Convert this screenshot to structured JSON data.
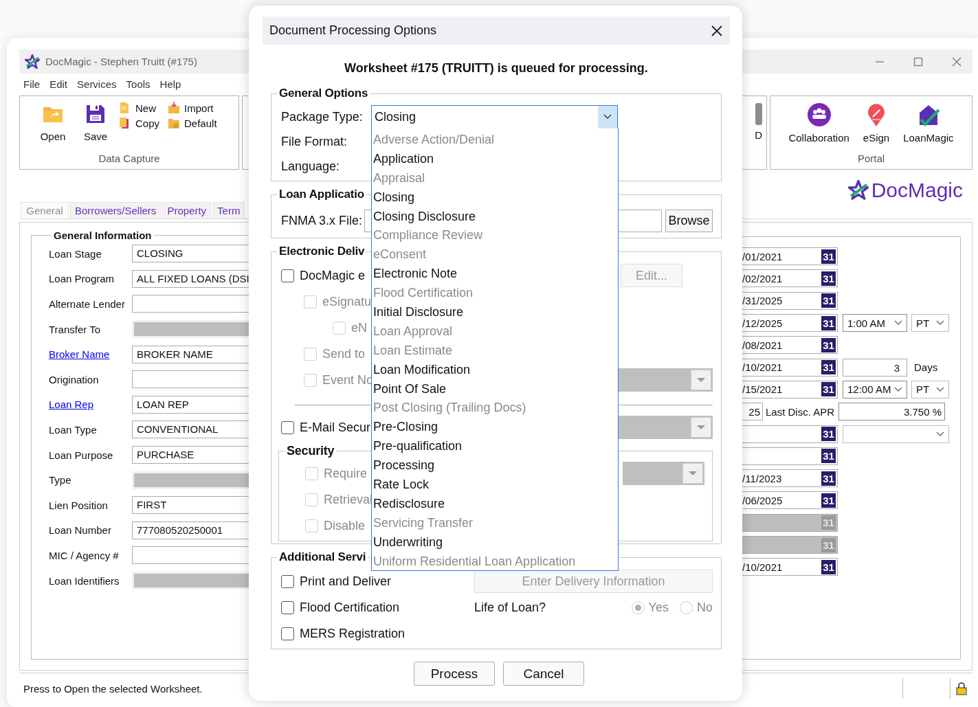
{
  "app": {
    "title": "DocMagic - Stephen Truitt (#175)",
    "menu": [
      "File",
      "Edit",
      "Services",
      "Tools",
      "Help"
    ],
    "data_capture": {
      "label": "Data Capture",
      "large": [
        "Open",
        "Save"
      ],
      "small": [
        "New",
        "Copy",
        "Import",
        "Default"
      ]
    },
    "partial_group": {
      "label": "D"
    },
    "portal": {
      "label": "Portal",
      "items": [
        "Collaboration",
        "eSign",
        "LoanMagic"
      ]
    },
    "brand": "DocMagic",
    "tabs": [
      {
        "label": "General",
        "selected": true
      },
      {
        "label": "Borrowers/Sellers",
        "selected": false
      },
      {
        "label": "Property",
        "selected": false
      },
      {
        "label": "Term",
        "selected": false
      }
    ],
    "general_information": {
      "title": "General Information",
      "rows": [
        {
          "label": "Loan Stage",
          "value": "CLOSING",
          "link": false,
          "disabled": false
        },
        {
          "label": "Loan Program",
          "value": "ALL FIXED LOANS (DSI",
          "link": false,
          "disabled": false
        },
        {
          "label": "Alternate Lender",
          "link": false,
          "disabled": false
        },
        {
          "label": "Transfer To",
          "link": false,
          "disabled": true
        },
        {
          "label": "Broker Name",
          "value": "BROKER NAME",
          "link": true,
          "disabled": false
        },
        {
          "label": "Origination",
          "link": false,
          "disabled": false
        },
        {
          "label": "Loan Rep",
          "value": "LOAN REP",
          "link": true,
          "disabled": false
        },
        {
          "label": "Loan Type",
          "value": "CONVENTIONAL",
          "link": false,
          "disabled": false
        },
        {
          "label": "Loan Purpose",
          "value": "PURCHASE",
          "link": false,
          "disabled": false
        },
        {
          "label": "Type",
          "link": false,
          "disabled": true
        },
        {
          "label": "Lien Position",
          "value": "FIRST",
          "link": false,
          "disabled": false
        },
        {
          "label": "Loan Number",
          "value": "777080520250001",
          "link": false,
          "disabled": false
        },
        {
          "label": "MIC / Agency #",
          "link": false,
          "disabled": false
        },
        {
          "label": "Loan Identifiers",
          "link": false,
          "disabled": true
        }
      ]
    },
    "date_rows": [
      {
        "kind": "date",
        "date": "/01/2021",
        "calendar": "31",
        "disabled": false
      },
      {
        "kind": "date",
        "date": "/02/2021",
        "calendar": "31",
        "disabled": false
      },
      {
        "kind": "date",
        "date": "/31/2025",
        "calendar": "31",
        "disabled": false
      },
      {
        "kind": "time",
        "date": "/12/2025",
        "calendar": "31",
        "disabled": false,
        "time": "1:00 AM",
        "zone": "PT"
      },
      {
        "kind": "date",
        "date": "/08/2021",
        "calendar": "31",
        "disabled": false
      },
      {
        "kind": "days",
        "date": "/10/2021",
        "calendar": "31",
        "disabled": false,
        "days": "3",
        "unit": "Days"
      },
      {
        "kind": "time",
        "date": "/15/2021",
        "calendar": "31",
        "disabled": false,
        "time": "12:00 AM",
        "zone": "PT"
      },
      {
        "kind": "apr",
        "count": "25",
        "label": "Last Disc. APR",
        "value": "3.750 %"
      },
      {
        "kind": "select",
        "calendar": "31",
        "disabled": false
      },
      {
        "kind": "date",
        "calendar": "31",
        "disabled": false
      },
      {
        "kind": "date",
        "date": "/11/2023",
        "calendar": "31",
        "disabled": false
      },
      {
        "kind": "date",
        "date": "/06/2025",
        "calendar": "31",
        "disabled": false
      },
      {
        "kind": "date",
        "calendar": "31",
        "disabled": true
      },
      {
        "kind": "date",
        "calendar": "31",
        "disabled": true
      },
      {
        "kind": "date",
        "date": "/10/2021",
        "calendar": "31",
        "disabled": false
      }
    ],
    "status": "Press to Open the selected Worksheet."
  },
  "dialog": {
    "title": "Document Processing Options",
    "message": "Worksheet #175 (TRUITT) is queued for processing.",
    "general_options": {
      "legend": "General Options",
      "package_type": {
        "label": "Package Type:",
        "value": "Closing",
        "expanded": true,
        "options": [
          {
            "label": "Adverse Action/Denial",
            "disabled": true
          },
          {
            "label": "Application",
            "disabled": false
          },
          {
            "label": "Appraisal",
            "disabled": true
          },
          {
            "label": "Closing",
            "disabled": false
          },
          {
            "label": "Closing Disclosure",
            "disabled": false
          },
          {
            "label": "Compliance Review",
            "disabled": true
          },
          {
            "label": "eConsent",
            "disabled": true
          },
          {
            "label": "Electronic Note",
            "disabled": false
          },
          {
            "label": "Flood Certification",
            "disabled": true
          },
          {
            "label": "Initial Disclosure",
            "disabled": false
          },
          {
            "label": "Loan Approval",
            "disabled": true
          },
          {
            "label": "Loan Estimate",
            "disabled": true
          },
          {
            "label": "Loan Modification",
            "disabled": false
          },
          {
            "label": "Point Of Sale",
            "disabled": false
          },
          {
            "label": "Post Closing (Trailing Docs)",
            "disabled": true
          },
          {
            "label": "Pre-Closing",
            "disabled": false
          },
          {
            "label": "Pre-qualification",
            "disabled": false
          },
          {
            "label": "Processing",
            "disabled": false
          },
          {
            "label": "Rate Lock",
            "disabled": false
          },
          {
            "label": "Redisclosure",
            "disabled": false
          },
          {
            "label": "Servicing Transfer",
            "disabled": true
          },
          {
            "label": "Underwriting",
            "disabled": false
          },
          {
            "label": "Uniform Residential Loan Application",
            "disabled": true
          }
        ]
      },
      "file_format_label": "File Format:",
      "language_label": "Language:"
    },
    "loan_application": {
      "legend": "Loan Applicatio",
      "file_label": "FNMA 3.x File:",
      "browse": "Browse"
    },
    "electronic_delivery": {
      "legend": "Electronic Deliv",
      "items": [
        {
          "label": "DocMagic e",
          "checked": false,
          "disabled": false,
          "button": {
            "label": "Edit...",
            "disabled": true
          },
          "children": [
            {
              "label": "eSignatu",
              "checked": false,
              "disabled": true,
              "children": [
                {
                  "label": "eN",
                  "checked": false,
                  "disabled": true
                }
              ]
            },
            {
              "label": "Send to",
              "checked": false,
              "disabled": true
            },
            {
              "label": "Event No",
              "checked": false,
              "disabled": true,
              "select": {
                "disabled": true
              }
            }
          ]
        }
      ],
      "email": {
        "label": "E-Mail Secur",
        "checked": false,
        "disabled": false,
        "select": {
          "disabled": true
        }
      },
      "security": {
        "legend": "Security",
        "items": [
          {
            "label": "Require",
            "checked": false,
            "disabled": true,
            "select": {
              "disabled": true
            }
          },
          {
            "label": "Retrieval",
            "checked": false,
            "disabled": true
          },
          {
            "label": "Disable",
            "checked": false,
            "disabled": true
          }
        ]
      }
    },
    "additional_services": {
      "legend": "Additional Servi",
      "print": {
        "label": "Print and Deliver",
        "checked": false,
        "disabled": false
      },
      "delivery_button": {
        "label": "Enter Delivery Information",
        "disabled": true
      },
      "flood": {
        "label": "Flood Certification",
        "checked": false,
        "disabled": false
      },
      "life_of_loan": {
        "label": "Life of Loan?",
        "options": [
          {
            "label": "Yes",
            "selected": true,
            "disabled": true
          },
          {
            "label": "No",
            "selected": false,
            "disabled": true
          }
        ]
      },
      "mers": {
        "label": "MERS Registration",
        "checked": false,
        "disabled": false
      }
    },
    "buttons": [
      "Process",
      "Cancel"
    ]
  }
}
